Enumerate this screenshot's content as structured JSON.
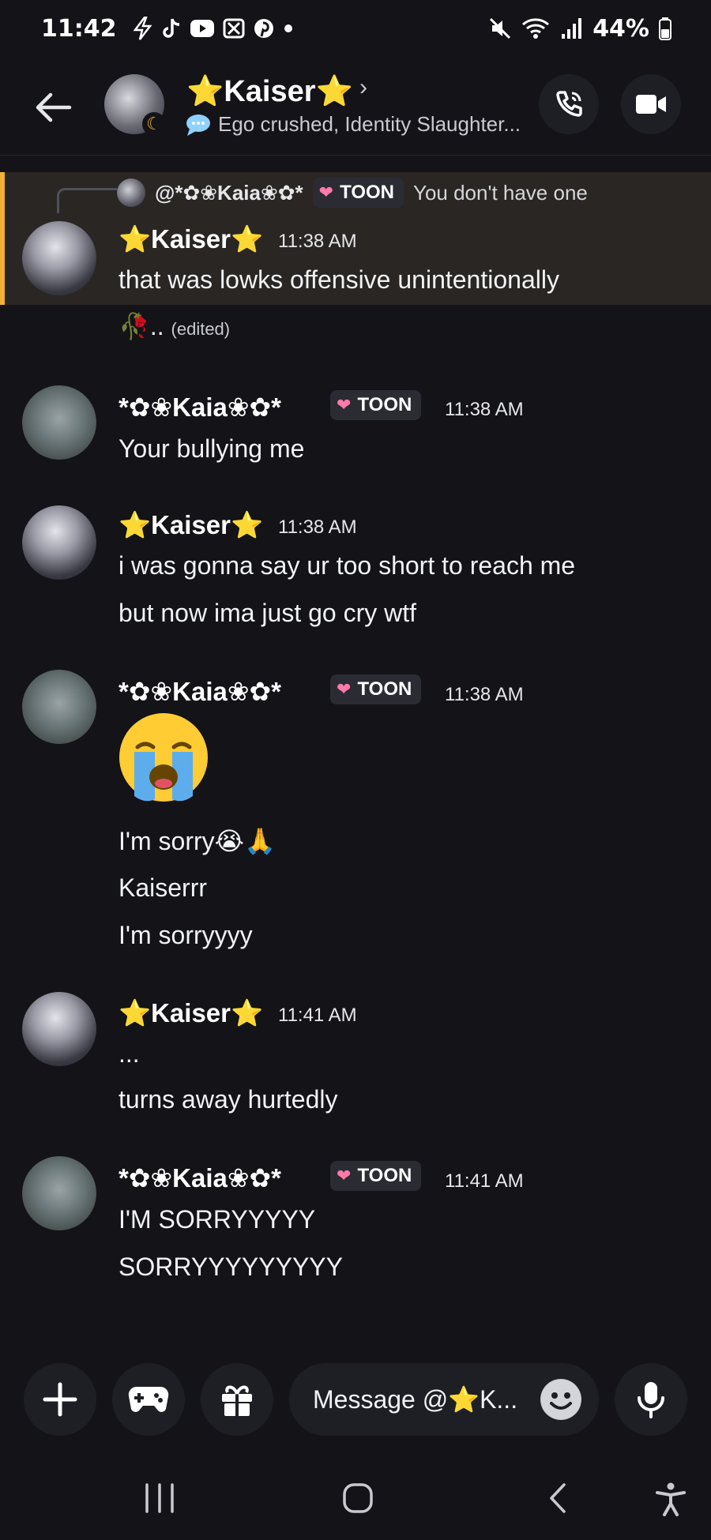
{
  "status_bar": {
    "time": "11:42",
    "battery": "44%",
    "icons": [
      "bolt-icon",
      "tiktok-icon",
      "youtube-icon",
      "x-icon",
      "pinterest-icon",
      "dot-icon",
      "mute-icon",
      "wifi-icon",
      "signal-icon",
      "battery-icon"
    ]
  },
  "header": {
    "name": "⭐Kaiser⭐",
    "status_text": "Ego crushed, Identity Slaughter...",
    "chevron": "›"
  },
  "reply": {
    "author": "@*✿❀Kaia❀✿*",
    "tag": "TOON",
    "text": "You don't have one"
  },
  "messages": [
    {
      "author": "⭐Kaiser⭐",
      "time": "11:38 AM",
      "lines": [
        "that was lowks offensive unintentionally"
      ],
      "extra": "🥀.. ",
      "edited": "(edited)"
    },
    {
      "author": "*✿❀Kaia❀✿*",
      "tag": "TOON",
      "time": "11:38 AM",
      "lines": [
        "Your bullying me"
      ]
    },
    {
      "author": "⭐Kaiser⭐",
      "time": "11:38 AM",
      "lines": [
        "i was gonna say ur too short to reach me",
        "but now ima just go cry wtf"
      ]
    },
    {
      "author": "*✿❀Kaia❀✿*",
      "tag": "TOON",
      "time": "11:38 AM",
      "lines": [
        "I'm sorry😭🙏",
        "Kaiserrr",
        "I'm sorryyyy"
      ]
    },
    {
      "author": "⭐Kaiser⭐",
      "time": "11:41 AM",
      "lines": [
        "...",
        "turns away hurtedly"
      ]
    },
    {
      "author": "*✿❀Kaia❀✿*",
      "tag": "TOON",
      "time": "11:41 AM",
      "lines": [
        "I'M SORRYYYYY",
        "SORRYYYYYYYYY"
      ]
    }
  ],
  "composer": {
    "placeholder": "Message @⭐K..."
  },
  "colors": {
    "background": "#131318",
    "accent_reply": "#f0b232",
    "button_bg": "#1e1f25"
  }
}
